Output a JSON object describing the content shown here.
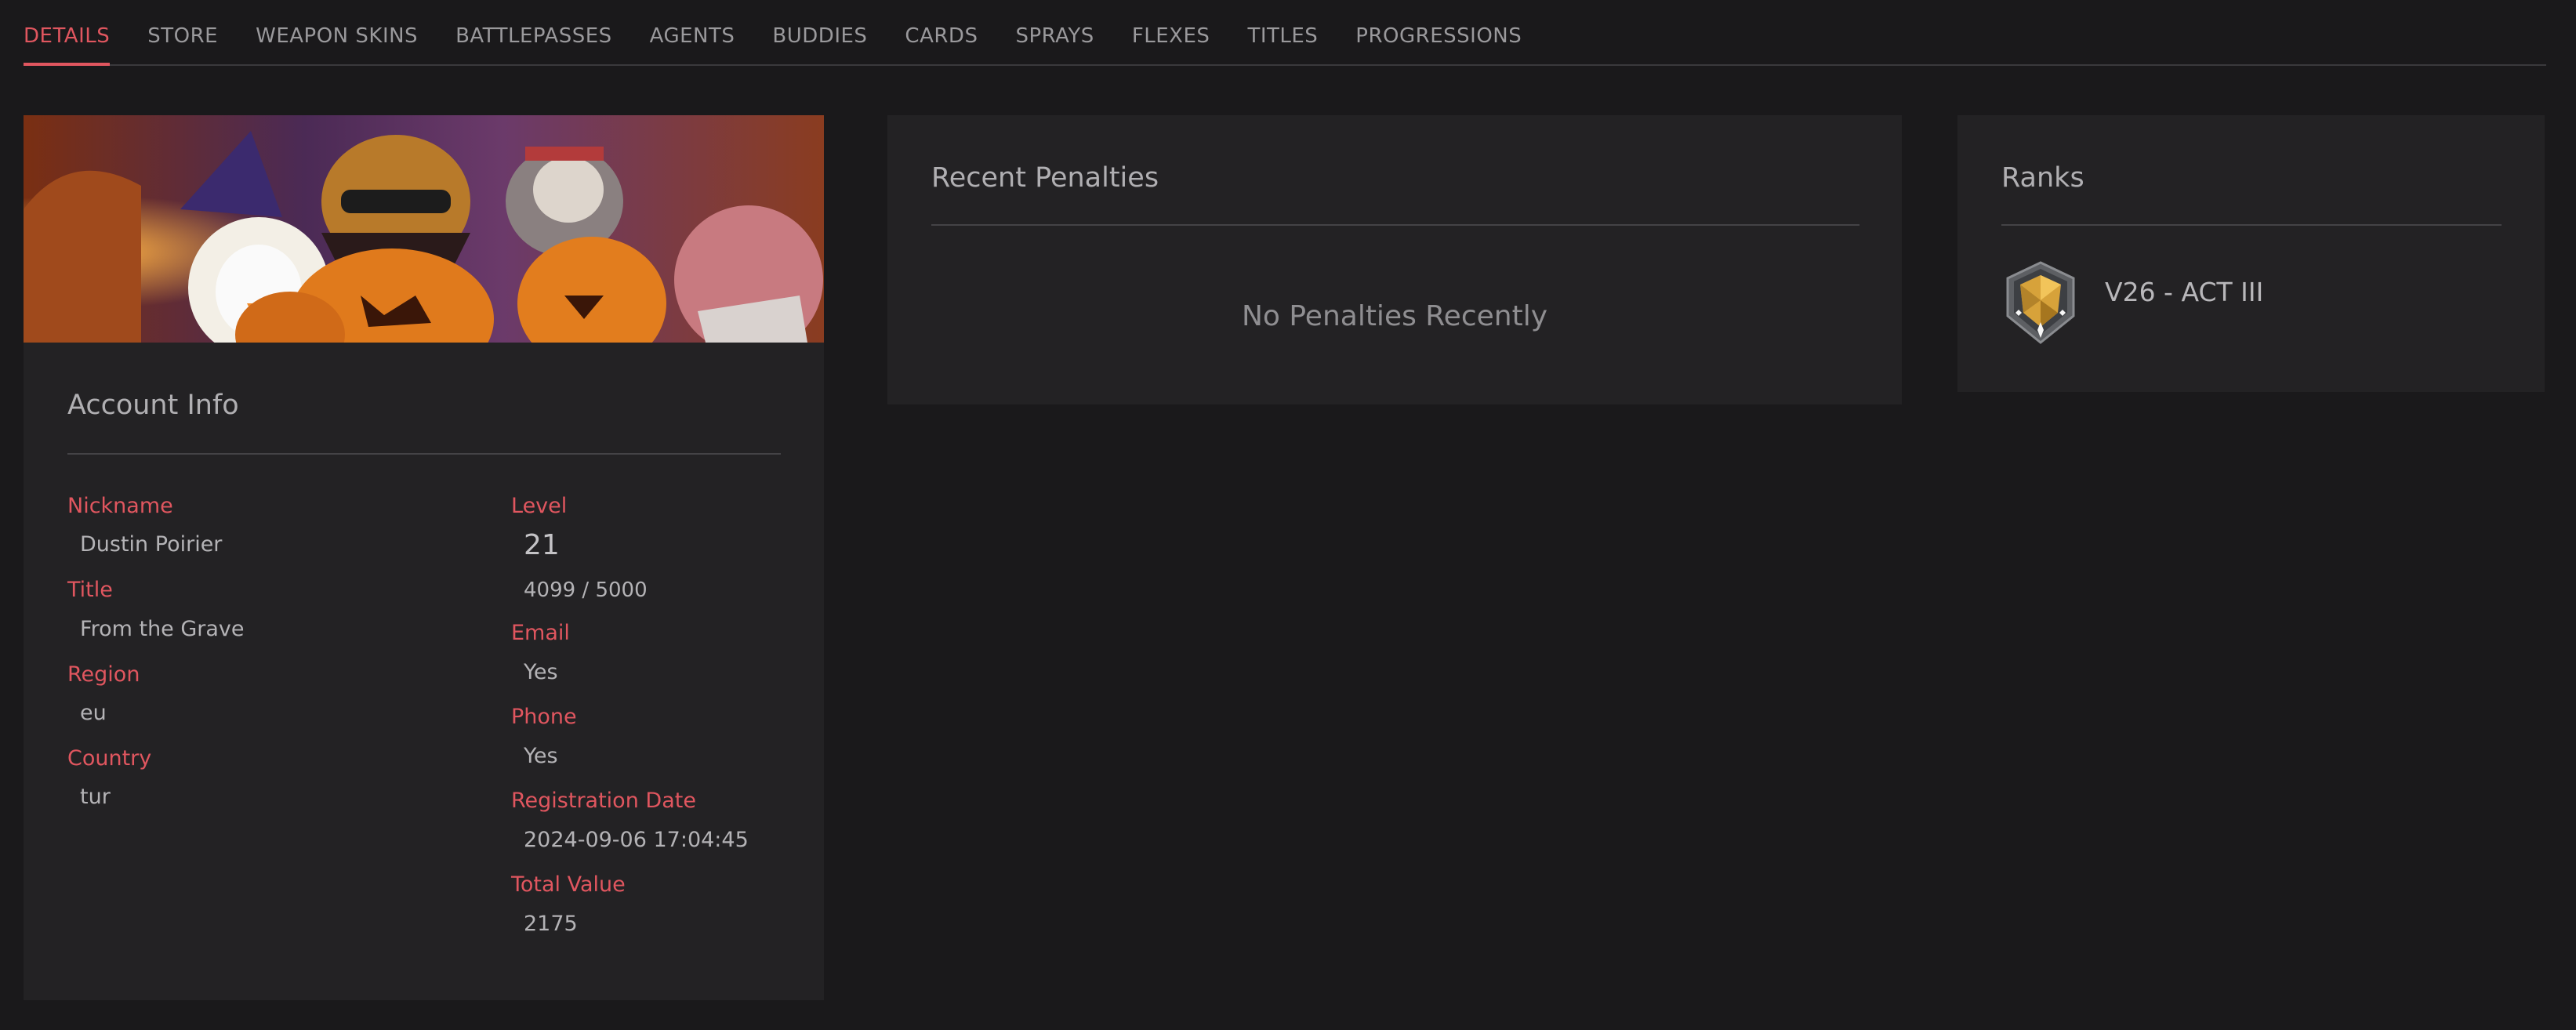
{
  "tabs": [
    {
      "label": "DETAILS",
      "active": true
    },
    {
      "label": "STORE"
    },
    {
      "label": "WEAPON SKINS"
    },
    {
      "label": "BATTLEPASSES"
    },
    {
      "label": "AGENTS"
    },
    {
      "label": "BUDDIES"
    },
    {
      "label": "CARDS"
    },
    {
      "label": "SPRAYS"
    },
    {
      "label": "FLEXES"
    },
    {
      "label": "TITLES"
    },
    {
      "label": "PROGRESSIONS"
    }
  ],
  "account": {
    "title": "Account Info",
    "nickname_label": "Nickname",
    "nickname": "Dustin Poirier",
    "title_label": "Title",
    "player_title": "From the Grave",
    "region_label": "Region",
    "region": "eu",
    "country_label": "Country",
    "country": "tur",
    "level_label": "Level",
    "level": "21",
    "level_progress": "4099 / 5000",
    "email_label": "Email",
    "email": "Yes",
    "phone_label": "Phone",
    "phone": "Yes",
    "registration_label": "Registration Date",
    "registration": "2024-09-06 17:04:45",
    "total_value_label": "Total Value",
    "total_value": "2175"
  },
  "penalties": {
    "title": "Recent Penalties",
    "empty_message": "No Penalties Recently"
  },
  "ranks": {
    "title": "Ranks",
    "entry": "V26 - ACT III"
  },
  "colors": {
    "accent": "#e0565f",
    "background": "#1a191b",
    "card": "#232224"
  }
}
